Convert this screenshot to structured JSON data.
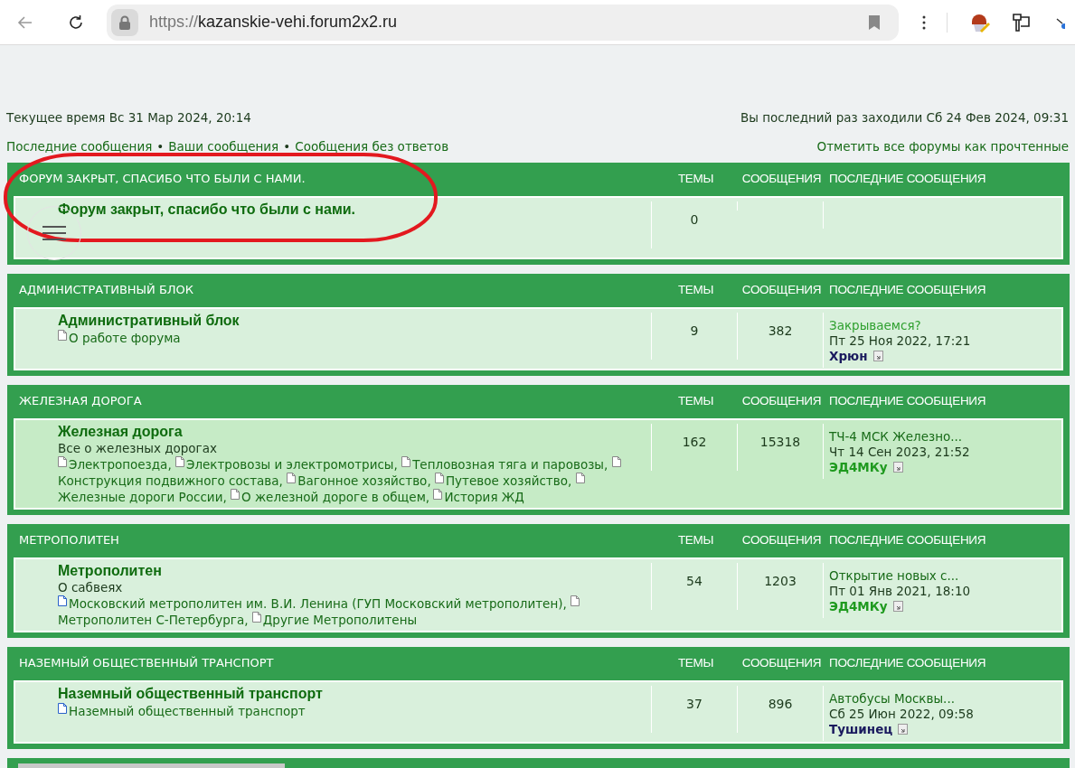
{
  "browser": {
    "url_scheme": "https://",
    "url_host": "kazanskie-vehi.forum2x2.ru"
  },
  "top": {
    "current_time": "Текущее время Вс 31 Мар 2024, 20:14",
    "last_visit": "Вы последний раз заходили Сб 24 Фев 2024, 09:31",
    "links": [
      "Последние сообщения",
      "Ваши сообщения",
      "Сообщения без ответов"
    ],
    "separator": "•",
    "mark_read": "Отметить все форумы как прочтенные"
  },
  "categories": [
    {
      "title": "ФОРУМ ЗАКРЫТ, СПАСИБО ЧТО БЫЛИ С НАМИ.",
      "columns": [
        "ТЕМЫ",
        "СООБЩЕНИЯ",
        "ПОСЛЕДНИЕ СООБЩЕНИЯ"
      ],
      "forum": {
        "name": "Форум закрыт, спасибо что были с нами.",
        "highlighted": false,
        "topics": "0"
      }
    },
    {
      "title": "АДМИНИСТРАТИВНЫЙ БЛОК",
      "columns": [
        "ТЕМЫ",
        "СООБЩЕНИЯ",
        "ПОСЛЕДНИЕ СООБЩЕНИЯ"
      ],
      "forum": {
        "name": "Административный блок",
        "highlighted": false,
        "topics": "9",
        "posts": "382",
        "subforums": [
          {
            "name": "О работе форума",
            "unread": false
          }
        ],
        "last": {
          "topic": "Закрываемся?",
          "date": "Пт 25 Ноя 2022, 17:21",
          "author": "Хрюн",
          "color": "#1a1a5e"
        }
      }
    },
    {
      "title": "ЖЕЛЕЗНАЯ ДОРОГА",
      "columns": [
        "ТЕМЫ",
        "СООБЩЕНИЯ",
        "ПОСЛЕДНИЕ СООБЩЕНИЯ"
      ],
      "forum": {
        "name": "Железная дорога",
        "highlighted": true,
        "description": "Все о железных дорогах",
        "topics": "162",
        "posts": "15318",
        "subforums": [
          {
            "name": "Электропоезда,",
            "unread": false
          },
          {
            "name": "Электровозы и электромотрисы,",
            "unread": false
          },
          {
            "name": "Тепловозная тяга и паровозы,",
            "unread": false
          },
          {
            "name": "Конструкция подвижного состава,",
            "unread": false
          },
          {
            "name": "Вагонное хозяйство,",
            "unread": false
          },
          {
            "name": "Путевое хозяйство,",
            "unread": false
          },
          {
            "name": "Железные дороги России,",
            "unread": false
          },
          {
            "name": "О железной дороге в общем,",
            "unread": false
          },
          {
            "name": "История ЖД",
            "unread": false
          }
        ],
        "last": {
          "topic": "ТЧ-4 МСК Железно...",
          "date": "Чт 14 Сен 2023, 21:52",
          "author": "ЭД4МКу",
          "color": "#1f9a1f"
        }
      }
    },
    {
      "title": "МЕТРОПОЛИТЕН",
      "columns": [
        "ТЕМЫ",
        "СООБЩЕНИЯ",
        "ПОСЛЕДНИЕ СООБЩЕНИЯ"
      ],
      "forum": {
        "name": "Метрополитен",
        "highlighted": false,
        "description": "О сабвеях",
        "topics": "54",
        "posts": "1203",
        "subforums": [
          {
            "name": "Московский метрополитен им. В.И. Ленина (ГУП Московский метрополитен),",
            "unread": true
          },
          {
            "name": "Метрополитен С-Петербурга,",
            "unread": false
          },
          {
            "name": "Другие Метрополитены",
            "unread": false
          }
        ],
        "last": {
          "topic": "Открытие новых с...",
          "date": "Пт 01 Янв 2021, 18:10",
          "author": "ЭД4МКу",
          "color": "#1f9a1f"
        }
      }
    },
    {
      "title": "НАЗЕМНЫЙ ОБЩЕСТВЕННЫЙ ТРАНСПОРТ",
      "columns": [
        "ТЕМЫ",
        "СООБЩЕНИЯ",
        "ПОСЛЕДНИЕ СООБЩЕНИЯ"
      ],
      "forum": {
        "name": "Наземный общественный транспорт",
        "highlighted": false,
        "topics": "37",
        "posts": "896",
        "subforums": [
          {
            "name": "Наземный общественный транспорт",
            "unread": true
          }
        ],
        "last": {
          "topic": "Автобусы Москвы...",
          "date": "Сб 25 Июн 2022, 09:58",
          "author": "Тушинец",
          "color": "#1a1a5e"
        }
      }
    }
  ]
}
